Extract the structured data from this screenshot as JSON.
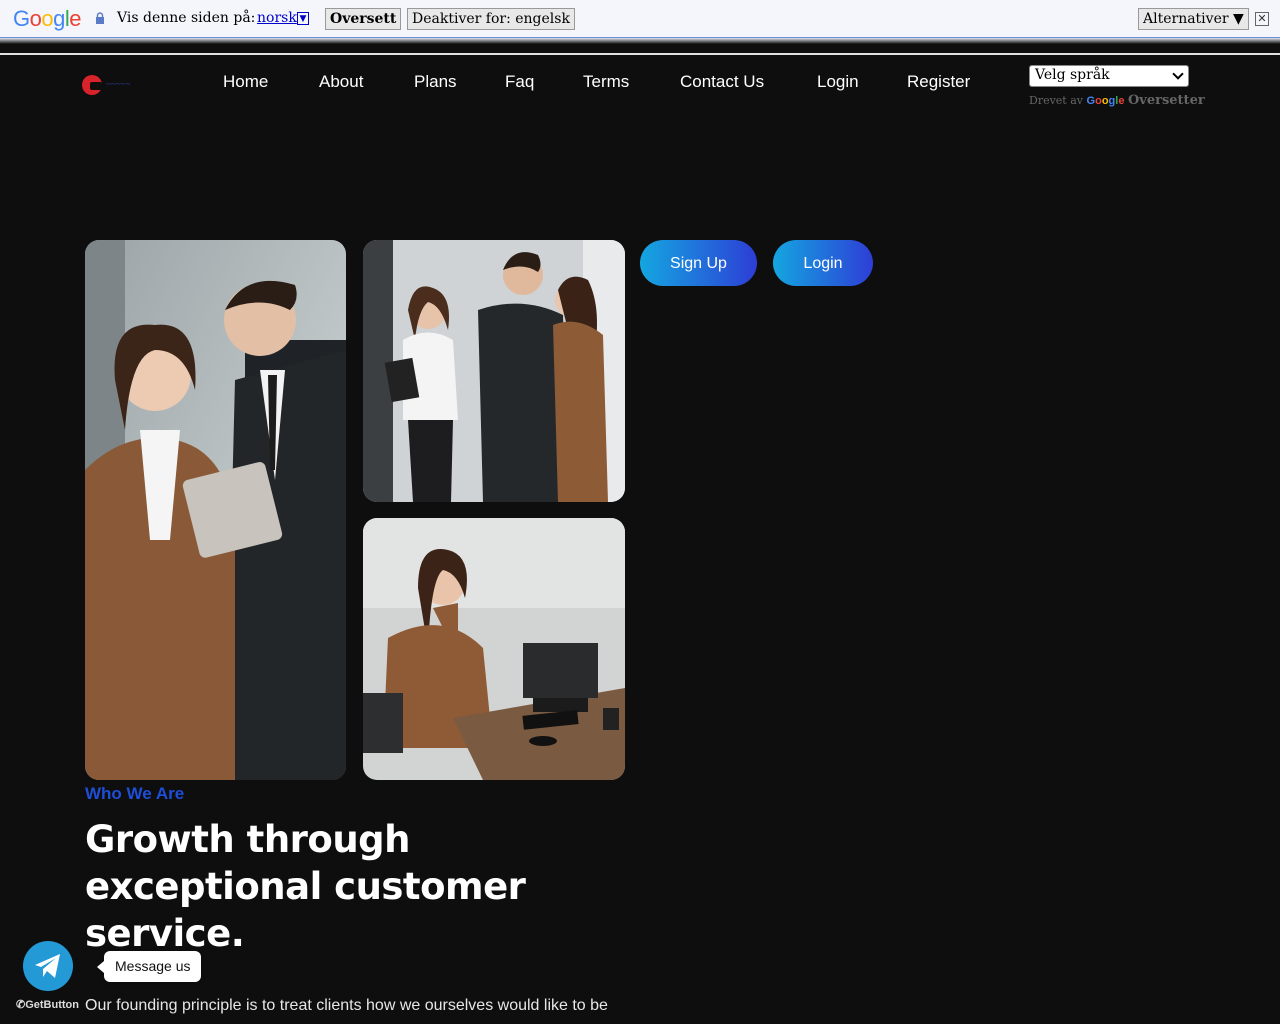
{
  "translate_bar": {
    "logo": "Google",
    "prompt": "Vis denne siden på:",
    "language": "norsk",
    "translate_button": "Oversett",
    "disable_button": "Deaktiver for: engelsk",
    "options_button": "Alternativer ▼",
    "close": "✕"
  },
  "nav": {
    "items": [
      "Home",
      "About",
      "Plans",
      "Faq",
      "Terms",
      "Contact Us",
      "Login",
      "Register"
    ]
  },
  "language_widget": {
    "select_value": "Velg språk",
    "powered_prefix": "Drevet av",
    "powered_brand": "Google",
    "powered_product": "Oversetter"
  },
  "hero_buttons": {
    "signup": "Sign Up",
    "login": "Login"
  },
  "about": {
    "eyebrow": "Who We Are",
    "headline": "Growth through exceptional customer service.",
    "paragraph": "Our founding principle is to treat clients how we ourselves would like to be"
  },
  "chat": {
    "tooltip": "Message us",
    "brand": "GetButton"
  },
  "colors": {
    "background": "#0f0e0e",
    "accent": "#1e4ed8",
    "button_gradient_start": "#14a6e0",
    "button_gradient_end": "#2d3ed6",
    "telegram": "#239ad6"
  }
}
